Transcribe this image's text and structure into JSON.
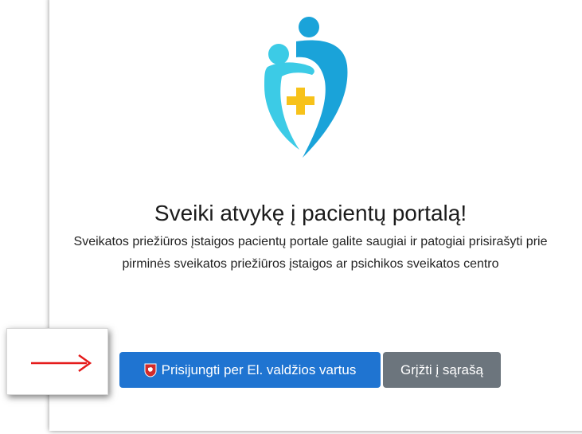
{
  "logo": {
    "icon": "patient-care-shield-icon",
    "colors": {
      "cyan": "#3ccbe6",
      "blue": "#1aa3d9",
      "cross": "#f7c21a"
    }
  },
  "welcome": {
    "title": "Sveiki atvykę į pacientų portalą!",
    "description": "Sveikatos priežiūros įstaigos pacientų portale galite saugiai ir patogiai prisirašyti prie pirminės sveikatos priežiūros įstaigos ar psichikos sveikatos centro"
  },
  "actions": {
    "login_label": "Prisijungti per El. valdžios vartus",
    "login_icon": "lithuania-coat-of-arms-icon",
    "back_label": "Grįžti į sąrašą"
  },
  "annotation": {
    "arrow_icon": "red-arrow-right-icon",
    "arrow_color": "#e51b1b"
  },
  "colors": {
    "primary": "#1f74d1",
    "secondary": "#6c757d"
  }
}
